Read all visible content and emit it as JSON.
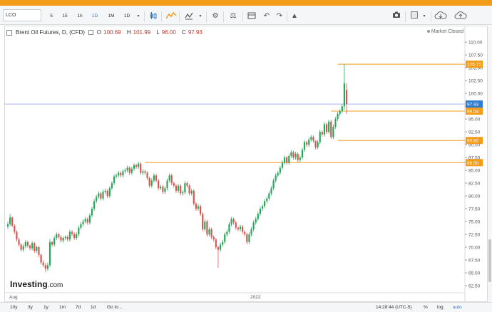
{
  "banner": {
    "color": "#f39c1a"
  },
  "toolbar": {
    "symbol": "LCO",
    "intervals": [
      "5",
      "15",
      "1h",
      "1D",
      "1M",
      "1D"
    ],
    "active_interval_index": 3,
    "icons": [
      "candles-icon",
      "chevron-down-icon",
      "mountain-icon",
      "indicators-icon",
      "chevron-down-icon",
      "settings-icon",
      "compare-icon",
      "undo-icon",
      "redo-icon",
      "alert-icon",
      "camera-icon",
      "layout-icon",
      "chevron-down-icon",
      "cloud-download-icon",
      "cloud-upload-icon"
    ]
  },
  "legend": {
    "title": "Brent Oil Futures, D, (CFD)",
    "open_label": "O",
    "open": "100.69",
    "high_label": "H",
    "high": "101.99",
    "low_label": "L",
    "low": "96.00",
    "close_label": "C",
    "close": "97.93"
  },
  "market_status": "Market Closed",
  "watermark": {
    "main": "Investing",
    "suffix": ".com"
  },
  "time_axis": {
    "labels": [
      "Aug",
      "2022"
    ]
  },
  "bottombar": {
    "ranges": [
      "10y",
      "3y",
      "1y",
      "1m",
      "7d",
      "1d",
      "Go to..."
    ],
    "time": "14:28:44 (UTC-5)",
    "toggles": [
      "%",
      "log",
      "auto"
    ]
  },
  "chart_data": {
    "type": "candlestick",
    "ylim": [
      61.25,
      111
    ],
    "y_ticks": [
      62.5,
      65,
      67.5,
      70,
      72.5,
      75,
      77.5,
      80,
      82.5,
      85,
      87.5,
      90,
      92.5,
      95,
      97.5,
      100,
      102.5,
      105,
      107.5,
      110
    ],
    "price_labels": [
      {
        "value": 105.71,
        "text": "105.71",
        "color": "#f39c1a"
      },
      {
        "value": 97.93,
        "text": "97.93",
        "color": "#2e7bd6"
      },
      {
        "value": 96.54,
        "text": "96.54",
        "color": "#f39c1a"
      },
      {
        "value": 90.82,
        "text": "90.82",
        "color": "#f39c1a"
      },
      {
        "value": 86.5,
        "text": "86.50",
        "color": "#f39c1a"
      }
    ],
    "levels": [
      {
        "value": 105.71,
        "from_index": 149
      },
      {
        "value": 96.54,
        "from_index": 146
      },
      {
        "value": 90.82,
        "from_index": 149
      },
      {
        "value": 86.5,
        "from_index": 62
      }
    ],
    "current_price": 97.93,
    "up_color": "#26a65b",
    "down_color": "#d9534f",
    "closes": [
      74.5,
      75.8,
      74.2,
      73.0,
      71.5,
      70.5,
      69.5,
      70.2,
      71.0,
      70.3,
      69.8,
      70.8,
      69.3,
      70.0,
      68.5,
      67.0,
      66.5,
      65.8,
      66.5,
      71.0,
      70.5,
      71.8,
      72.5,
      72.0,
      71.3,
      71.8,
      72.0,
      71.5,
      73.0,
      72.6,
      71.8,
      72.5,
      73.8,
      74.5,
      75.0,
      75.5,
      74.8,
      76.2,
      77.5,
      79.0,
      79.8,
      80.5,
      79.5,
      80.8,
      81.0,
      80.0,
      81.5,
      82.5,
      83.8,
      84.0,
      84.5,
      84.0,
      84.8,
      85.0,
      85.5,
      84.5,
      85.3,
      86.0,
      85.7,
      86.3,
      84.5,
      84.8,
      84.5,
      83.5,
      82.0,
      83.0,
      84.0,
      83.0,
      81.5,
      81.8,
      80.8,
      81.5,
      83.0,
      84.0,
      82.5,
      82.0,
      81.0,
      82.0,
      80.5,
      80.7,
      82.5,
      82.0,
      80.5,
      81.0,
      78.5,
      77.5,
      78.0,
      76.5,
      73.5,
      75.0,
      72.5,
      73.5,
      72.0,
      71.5,
      70.0,
      69.5,
      70.5,
      71.0,
      72.5,
      73.0,
      74.5,
      75.5,
      74.8,
      73.8,
      73.5,
      74.0,
      73.0,
      72.5,
      71.0,
      72.5,
      73.5,
      74.8,
      75.5,
      76.5,
      77.5,
      78.0,
      79.0,
      79.5,
      80.5,
      81.5,
      83.0,
      84.0,
      84.5,
      85.5,
      86.5,
      87.5,
      86.5,
      87.8,
      88.5,
      87.5,
      88.2,
      87.0,
      87.5,
      89.0,
      90.5,
      90.0,
      91.0,
      91.5,
      90.8,
      89.5,
      90.5,
      92.5,
      92.0,
      94.0,
      92.5,
      94.5,
      91.5,
      93.5,
      95.0,
      96.0,
      96.5,
      97.5,
      102.0,
      97.93
    ],
    "opens": [
      74.0,
      74.5,
      75.8,
      74.2,
      73.0,
      71.5,
      70.5,
      69.5,
      70.2,
      71.0,
      70.3,
      69.8,
      70.8,
      69.3,
      70.0,
      68.5,
      67.0,
      66.5,
      65.8,
      66.5,
      71.0,
      70.5,
      71.8,
      72.5,
      72.0,
      71.3,
      71.8,
      72.0,
      71.5,
      73.0,
      72.6,
      71.8,
      72.5,
      73.8,
      74.5,
      75.0,
      75.5,
      74.8,
      76.2,
      77.5,
      79.0,
      79.8,
      80.5,
      79.5,
      80.8,
      81.0,
      80.0,
      81.5,
      82.5,
      83.8,
      84.0,
      84.5,
      84.0,
      84.8,
      85.0,
      85.5,
      84.5,
      85.3,
      86.0,
      85.7,
      86.3,
      84.5,
      84.8,
      84.5,
      83.5,
      82.0,
      83.0,
      84.0,
      83.0,
      81.5,
      81.8,
      80.8,
      81.5,
      83.0,
      84.0,
      82.5,
      82.0,
      81.0,
      82.0,
      80.5,
      80.7,
      82.5,
      82.0,
      80.5,
      81.0,
      78.5,
      77.5,
      78.0,
      76.5,
      73.5,
      75.0,
      72.5,
      73.5,
      72.0,
      71.5,
      70.0,
      69.5,
      70.5,
      71.0,
      72.5,
      73.0,
      74.5,
      75.5,
      74.8,
      73.8,
      73.5,
      74.0,
      73.0,
      72.5,
      71.0,
      72.5,
      73.5,
      74.8,
      75.5,
      76.5,
      77.5,
      78.0,
      79.0,
      79.5,
      80.5,
      81.5,
      83.0,
      84.0,
      84.5,
      85.5,
      86.5,
      87.5,
      86.5,
      87.8,
      88.5,
      87.5,
      88.2,
      87.0,
      87.5,
      89.0,
      90.5,
      90.0,
      91.0,
      91.5,
      90.8,
      89.5,
      90.5,
      92.5,
      92.0,
      94.0,
      92.5,
      94.5,
      91.5,
      93.5,
      95.0,
      96.0,
      96.5,
      97.5,
      100.69
    ],
    "highs": [
      75.0,
      76.5,
      76.0,
      74.5,
      73.3,
      71.8,
      70.8,
      70.6,
      71.4,
      71.3,
      70.5,
      71.2,
      71.0,
      70.3,
      70.3,
      68.8,
      67.4,
      66.9,
      67.0,
      71.6,
      71.2,
      72.2,
      72.9,
      72.8,
      72.3,
      72.1,
      72.3,
      72.3,
      73.4,
      73.3,
      72.9,
      72.9,
      74.2,
      74.9,
      75.4,
      75.9,
      75.8,
      76.6,
      77.9,
      79.4,
      80.2,
      80.9,
      80.8,
      81.2,
      81.4,
      81.3,
      81.9,
      82.9,
      84.2,
      84.4,
      84.9,
      84.8,
      85.2,
      85.4,
      85.9,
      85.8,
      85.7,
      86.4,
      86.3,
      86.7,
      86.6,
      85.2,
      85.1,
      84.8,
      83.8,
      83.4,
      84.4,
      84.3,
      83.3,
      82.2,
      82.1,
      81.9,
      83.4,
      84.4,
      84.3,
      82.8,
      82.3,
      82.4,
      82.3,
      81.1,
      82.9,
      82.8,
      82.3,
      81.4,
      81.3,
      78.8,
      78.4,
      78.3,
      76.8,
      75.4,
      75.3,
      73.9,
      73.8,
      72.3,
      71.8,
      70.3,
      70.9,
      71.4,
      72.9,
      73.4,
      74.9,
      75.9,
      75.8,
      75.1,
      74.1,
      74.4,
      74.3,
      73.3,
      72.8,
      72.9,
      73.9,
      75.2,
      75.9,
      76.9,
      77.9,
      78.4,
      79.4,
      79.9,
      80.9,
      81.9,
      83.4,
      84.4,
      84.9,
      85.9,
      86.9,
      87.9,
      87.8,
      88.2,
      88.9,
      88.8,
      88.6,
      88.5,
      87.9,
      89.4,
      90.9,
      90.8,
      91.4,
      91.9,
      91.8,
      90.8,
      90.9,
      92.9,
      92.8,
      94.4,
      94.3,
      94.9,
      94.8,
      93.9,
      95.4,
      96.4,
      96.9,
      97.9,
      105.71,
      101.99
    ],
    "lows": [
      73.6,
      74.1,
      73.9,
      72.6,
      71.1,
      70.1,
      69.1,
      69.1,
      69.8,
      69.9,
      69.4,
      69.4,
      68.9,
      68.9,
      68.1,
      66.6,
      66.1,
      65.1,
      65.4,
      66.1,
      70.1,
      70.1,
      71.4,
      71.6,
      70.9,
      70.9,
      71.4,
      71.1,
      71.1,
      72.2,
      71.4,
      71.4,
      72.1,
      73.4,
      74.1,
      74.6,
      74.4,
      74.4,
      75.8,
      77.1,
      78.6,
      79.4,
      79.1,
      79.1,
      80.4,
      79.6,
      79.6,
      81.1,
      82.1,
      83.4,
      83.6,
      83.6,
      83.6,
      84.4,
      84.6,
      84.1,
      84.1,
      84.9,
      85.3,
      85.3,
      84.1,
      84.1,
      84.1,
      83.1,
      81.6,
      81.6,
      82.6,
      82.6,
      81.1,
      81.1,
      80.4,
      80.4,
      81.1,
      82.6,
      82.1,
      81.6,
      80.6,
      80.6,
      80.1,
      80.1,
      80.3,
      81.6,
      80.1,
      80.1,
      78.1,
      77.1,
      77.1,
      76.1,
      73.1,
      73.1,
      72.1,
      72.1,
      71.6,
      71.1,
      69.6,
      66.0,
      69.1,
      70.1,
      70.6,
      72.1,
      72.6,
      74.1,
      74.4,
      73.4,
      73.1,
      73.1,
      72.6,
      72.1,
      70.6,
      70.6,
      72.1,
      73.1,
      74.4,
      75.1,
      76.1,
      77.1,
      77.6,
      78.6,
      79.1,
      80.1,
      81.1,
      82.6,
      83.6,
      84.1,
      85.1,
      86.1,
      86.1,
      86.1,
      87.4,
      87.1,
      87.1,
      86.6,
      86.6,
      87.1,
      88.6,
      89.6,
      89.6,
      90.6,
      90.4,
      89.1,
      89.1,
      90.1,
      91.6,
      91.6,
      92.1,
      92.1,
      91.1,
      91.1,
      93.1,
      94.6,
      95.6,
      96.1,
      96.8,
      96.0
    ]
  }
}
